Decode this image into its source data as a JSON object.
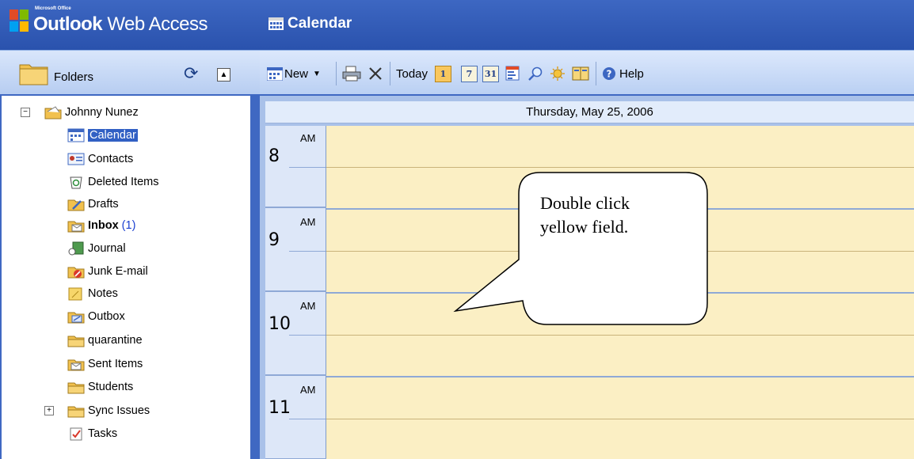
{
  "app": {
    "brand_small": "Microsoft Office",
    "title_bold": "Outlook",
    "title_light": " Web Access",
    "view_title": "Calendar"
  },
  "folders_pane": {
    "header_label": "Folders",
    "refresh_icon": "refresh-icon",
    "collapse_icon": "collapse-icon",
    "root": "Johnny Nunez",
    "items": [
      {
        "label": "Calendar",
        "icon": "calendar-icon",
        "selected": true
      },
      {
        "label": "Contacts",
        "icon": "contacts-icon"
      },
      {
        "label": "Deleted Items",
        "icon": "trash-icon"
      },
      {
        "label": "Drafts",
        "icon": "drafts-icon"
      },
      {
        "label": "Inbox",
        "count": "(1)",
        "icon": "inbox-icon",
        "bold": true
      },
      {
        "label": "Journal",
        "icon": "journal-icon"
      },
      {
        "label": "Junk E-mail",
        "icon": "junk-icon"
      },
      {
        "label": "Notes",
        "icon": "notes-icon"
      },
      {
        "label": "Outbox",
        "icon": "outbox-icon"
      },
      {
        "label": "quarantine",
        "icon": "folder-icon"
      },
      {
        "label": "Sent Items",
        "icon": "sent-icon"
      },
      {
        "label": "Students",
        "icon": "folder-icon"
      },
      {
        "label": "Sync Issues",
        "icon": "folder-icon",
        "expandable": true
      },
      {
        "label": "Tasks",
        "icon": "tasks-icon"
      }
    ]
  },
  "toolbar": {
    "new_label": "New",
    "today_label": "Today",
    "day_view": "1",
    "week_view": "7",
    "month_view": "31",
    "help_label": "Help"
  },
  "calendar": {
    "date_header": "Thursday, May 25, 2006",
    "hours": [
      {
        "hour": "8",
        "ampm": "AM"
      },
      {
        "hour": "9",
        "ampm": "AM"
      },
      {
        "hour": "10",
        "ampm": "AM"
      },
      {
        "hour": "11",
        "ampm": "AM"
      }
    ]
  },
  "callout": {
    "line1": "Double click",
    "line2": "yellow field."
  },
  "colors": {
    "banner": "#2f59b5",
    "toolbar": "#c7d8f5",
    "slot_yellow": "#fbefc4",
    "hour_column": "#dde7f8",
    "selection": "#3160c4"
  }
}
